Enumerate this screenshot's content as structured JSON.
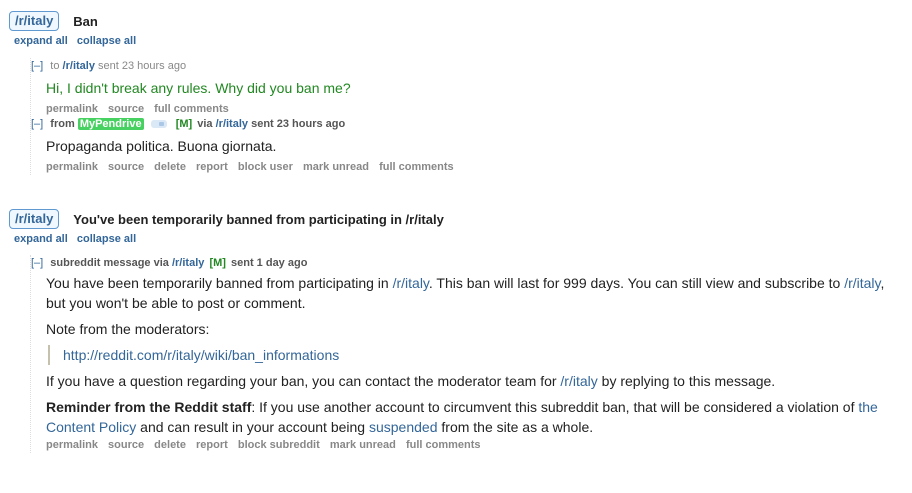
{
  "thread1": {
    "subreddit": "/r/italy",
    "subject": "Ban",
    "expand_all": "expand all",
    "collapse_all": "collapse all",
    "messages": [
      {
        "toggle": "[–]",
        "prefix": "to",
        "target": "/r/italy",
        "sent": "sent 23 hours ago",
        "body": "Hi, I didn't break any rules. Why did you ban me?",
        "actions": [
          "permalink",
          "source",
          "full comments"
        ]
      },
      {
        "toggle": "[–]",
        "prefix": "from",
        "user": "MyPendrive",
        "mod_badge": "[M]",
        "via": "via",
        "target": "/r/italy",
        "sent": "sent 23 hours ago",
        "body": "Propaganda politica. Buona giornata.",
        "actions": [
          "permalink",
          "source",
          "delete",
          "report",
          "block user",
          "mark unread",
          "full comments"
        ]
      }
    ]
  },
  "thread2": {
    "subreddit": "/r/italy",
    "subject": "You've been temporarily banned from participating in /r/italy",
    "expand_all": "expand all",
    "collapse_all": "collapse all",
    "message": {
      "toggle": "[–]",
      "prefix": "subreddit message via",
      "target": "/r/italy",
      "mod_badge": "[M]",
      "sent": "sent 1 day ago",
      "p1_a": "You have been temporarily banned from participating in ",
      "p1_link": "/r/italy",
      "p1_b": ". This ban will last for 999 days. You can still view and subscribe to ",
      "p1_link2": "/r/italy",
      "p1_c": ", but you won't be able to post or comment.",
      "p2": "Note from the moderators:",
      "quote_link": "http://reddit.com/r/italy/wiki/ban_informations",
      "p3_a": "If you have a question regarding your ban, you can contact the moderator team for ",
      "p3_link": "/r/italy",
      "p3_b": " by replying to this message.",
      "p4_bold": "Reminder from the Reddit staff",
      "p4_a": ": If you use another account to circumvent this subreddit ban, that will be considered a violation of ",
      "p4_link": "the Content Policy",
      "p4_b": " and can result in your account being ",
      "p4_link2": "suspended",
      "p4_c": " from the site as a whole.",
      "actions": [
        "permalink",
        "source",
        "delete",
        "report",
        "block subreddit",
        "mark unread",
        "full comments"
      ]
    }
  }
}
